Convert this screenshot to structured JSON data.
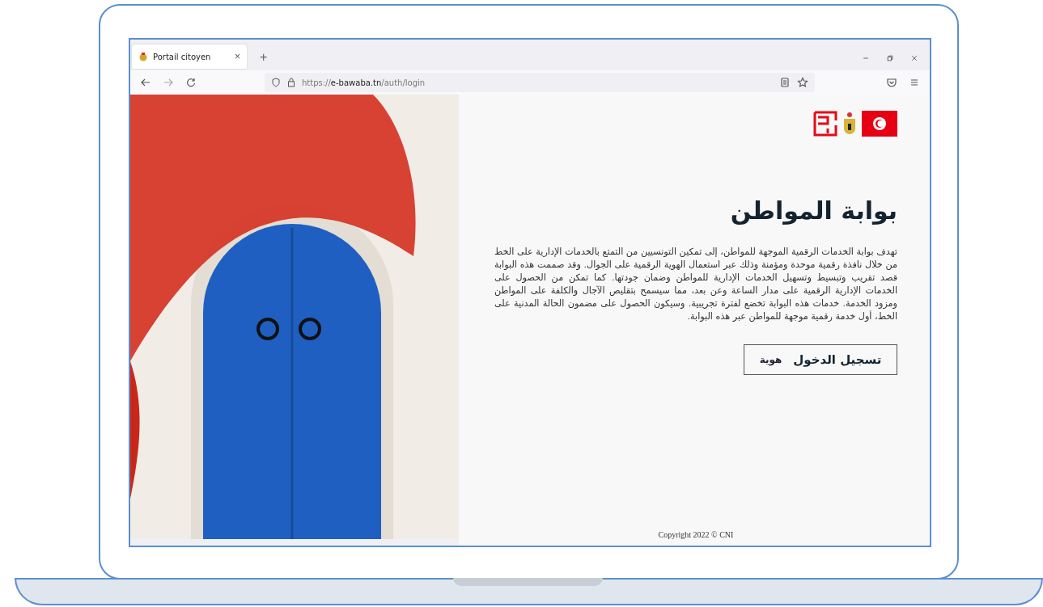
{
  "browser": {
    "tabs": [
      {
        "title": "Portail citoyen",
        "selected": true
      }
    ],
    "close_tab": "×",
    "new_tab": "+",
    "url": "https://**e-bawaba.tn**/auth/login"
  },
  "portal": {
    "title": "بوابة المواطن",
    "description": "تهدف بوابة الخدمات الرقمية الموجهة للمواطن، إلى تمكين التونسيين من التمتع بالخدمات الإدارية على الخط من خلال نافذة رقمية موحدة ومؤمنة وذلك عبر استعمال الهوية الرقمية على الجوال. وقد صممت هذه البوابة قصد تقريب وتبسيط وتسهيل الخدمات الإدارية للمواطن وضمان جودتها. كما تمكن من الحصول على الخدمات الإدارية الرقمية على مدار الساعة وعن بعد، مما سيسمح بتقليص الآجال والكلفة على المواطن ومزود الخدمة. خدمات هذه البوابة تخضع لفترة تجريبية. وسيكون الحصول على مضمون الحالة المدنية على الخط، أول خدمة رقمية موجهة للمواطن عبر هذه البوابة.",
    "login_button": {
      "label": "تسجيل الدخول",
      "logo": "هوية"
    },
    "copyright": "Copyright 2022 © CNI"
  }
}
